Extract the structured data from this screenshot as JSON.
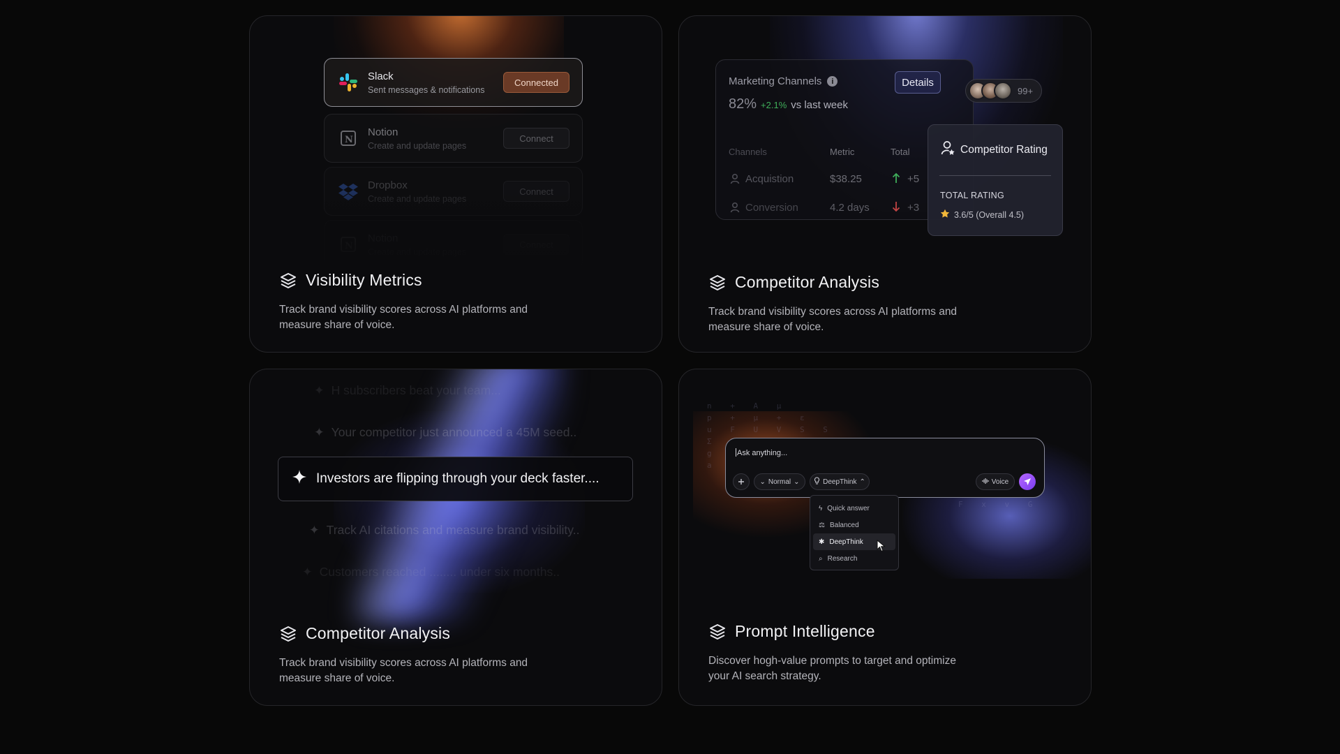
{
  "colors": {
    "page_bg": "#080808",
    "card_border": "#26262a",
    "accent_orange": "#e8783a",
    "accent_blue": "#7c82ff",
    "positive": "#3fae5a",
    "negative": "#d04848",
    "send_purple": "#9a4cf8"
  },
  "cards": [
    {
      "title": "Visibility Metrics",
      "description": "Track brand visibility scores across AI platforms and measure share of voice.",
      "icon": "layers-icon",
      "integrations": [
        {
          "name": "Slack",
          "subtitle": "Sent messages & notifications",
          "button": "Connected",
          "icon": "slack-icon",
          "connected": true
        },
        {
          "name": "Notion",
          "subtitle": "Create and update pages",
          "button": "Connect",
          "icon": "notion-icon",
          "connected": false
        },
        {
          "name": "Dropbox",
          "subtitle": "Create and update pages",
          "button": "Connect",
          "icon": "dropbox-icon",
          "connected": false
        },
        {
          "name": "Notion",
          "subtitle": "Create and update pages",
          "button": "Connect",
          "icon": "notion-icon",
          "connected": false
        }
      ]
    },
    {
      "title": "Competitor Analysis",
      "description": "Track brand visibility scores across AI platforms and measure share of voice.",
      "icon": "layers-icon",
      "marketing": {
        "title": "Marketing Channels",
        "details_button": "Details",
        "percentage": "82%",
        "delta": "+2.1%",
        "vs_text": "vs last week",
        "columns": [
          "Channels",
          "Metric",
          "Total"
        ],
        "rows": [
          {
            "channel": "Acquistion",
            "metric": "$38.25",
            "trend": "up",
            "total": "+5"
          },
          {
            "channel": "Conversion",
            "metric": "4.2 days",
            "trend": "down",
            "total": "+3"
          }
        ]
      },
      "avatars": {
        "count_label": "99+"
      },
      "rating": {
        "title": "Competitor Rating",
        "label": "TOTAL RATING",
        "value": "3.6/5  (Overall 4.5)"
      }
    },
    {
      "title": "Competitor Analysis",
      "description": "Track brand visibility scores across AI platforms and measure share of voice.",
      "icon": "layers-icon",
      "tickers": [
        "H subscribers beat your team...",
        "Your competitor just announced a 45M seed..",
        "Investors are flipping through your deck faster....",
        "Track AI citations and measure brand visibility..",
        "Customers reached ........ under six months.."
      ]
    },
    {
      "title": "Prompt Intelligence",
      "description": "Discover hogh-value prompts to target and optimize your AI search strategy.",
      "icon": "layers-icon",
      "chat": {
        "placeholder": "Ask anything...",
        "mode": "Normal",
        "model": "DeepThink",
        "voice": "Voice",
        "options": [
          {
            "label": "Quick answer",
            "icon": "lightning-icon"
          },
          {
            "label": "Balanced",
            "icon": "balance-icon"
          },
          {
            "label": "DeepThink",
            "icon": "brain-icon",
            "selected": true
          },
          {
            "label": "Research",
            "icon": "search-doc-icon"
          }
        ]
      }
    }
  ]
}
